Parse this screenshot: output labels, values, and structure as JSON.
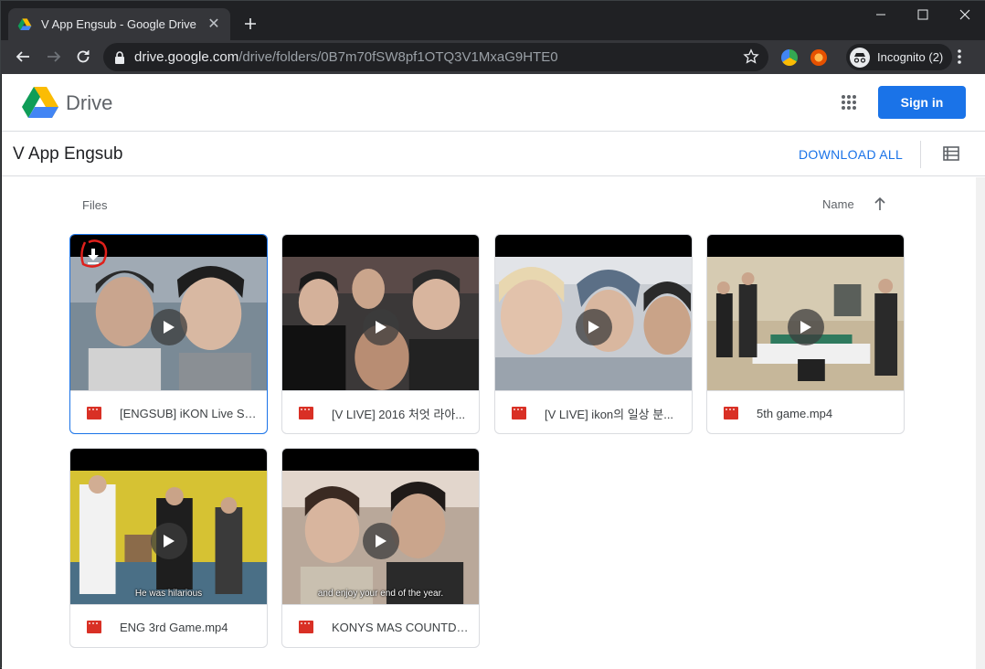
{
  "browser": {
    "tab_title": "V App Engsub - Google Drive",
    "new_tab_icon": "plus-icon",
    "url_host": "drive.google.com",
    "url_path": "/drive/folders/0B7m70fSW8pf1OTQ3V1MxaG9HTE0",
    "incognito_label": "Incognito (2)"
  },
  "drive": {
    "logo_text": "Drive",
    "signin_label": "Sign in",
    "folder_title": "V App Engsub",
    "download_all_label": "DOWNLOAD ALL",
    "files_label": "Files",
    "sort_label": "Name"
  },
  "files": [
    {
      "name": "[ENGSUB] iKON Live Sp...",
      "caption": ""
    },
    {
      "name": "[V LIVE] 2016 처엇 라아...",
      "caption": ""
    },
    {
      "name": "[V LIVE] ikon의 일상 분...",
      "caption": ""
    },
    {
      "name": "5th game.mp4",
      "caption": ""
    },
    {
      "name": "ENG 3rd Game.mp4",
      "caption": "He was hilarious"
    },
    {
      "name": "KONYS MAS COUNTDO...",
      "caption": "and enjoy your end of the year."
    }
  ],
  "colors": {
    "accent": "#1a73e8",
    "video_icon": "#d93025",
    "annotation": "#e0201b"
  }
}
